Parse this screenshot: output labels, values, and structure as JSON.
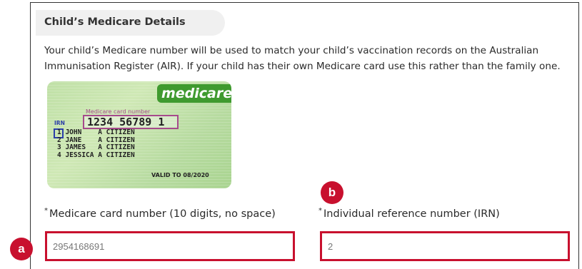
{
  "section": {
    "title": "Child’s Medicare Details",
    "intro": "Your child’s Medicare number will be used to match your child’s vaccination records on the Australian Immunisation Register (AIR). If your child has their own Medicare card use this rather than the family one."
  },
  "card": {
    "brand": "medicare",
    "caption": "Medicare card number",
    "number": "1234 56789 1",
    "irn_label": "IRN",
    "names": [
      "1 JOHN    A CITIZEN",
      "2 JANE    A CITIZEN",
      "3 JAMES   A CITIZEN",
      "4 JESSICA A CITIZEN"
    ],
    "valid_to": "VALID TO  08/2020",
    "colors": {
      "brand": "#3f9a2f",
      "number_box": "#a64a8c",
      "irn_box": "#2a3ea8"
    }
  },
  "fields": {
    "required_mark": "*",
    "medicare": {
      "label": "Medicare card number (10 digits, no space)",
      "value": "2954168691"
    },
    "irn": {
      "label": "Individual reference number (IRN)",
      "value": "2"
    }
  },
  "markers": {
    "a": "a",
    "b": "b",
    "color": "#c8102e"
  }
}
